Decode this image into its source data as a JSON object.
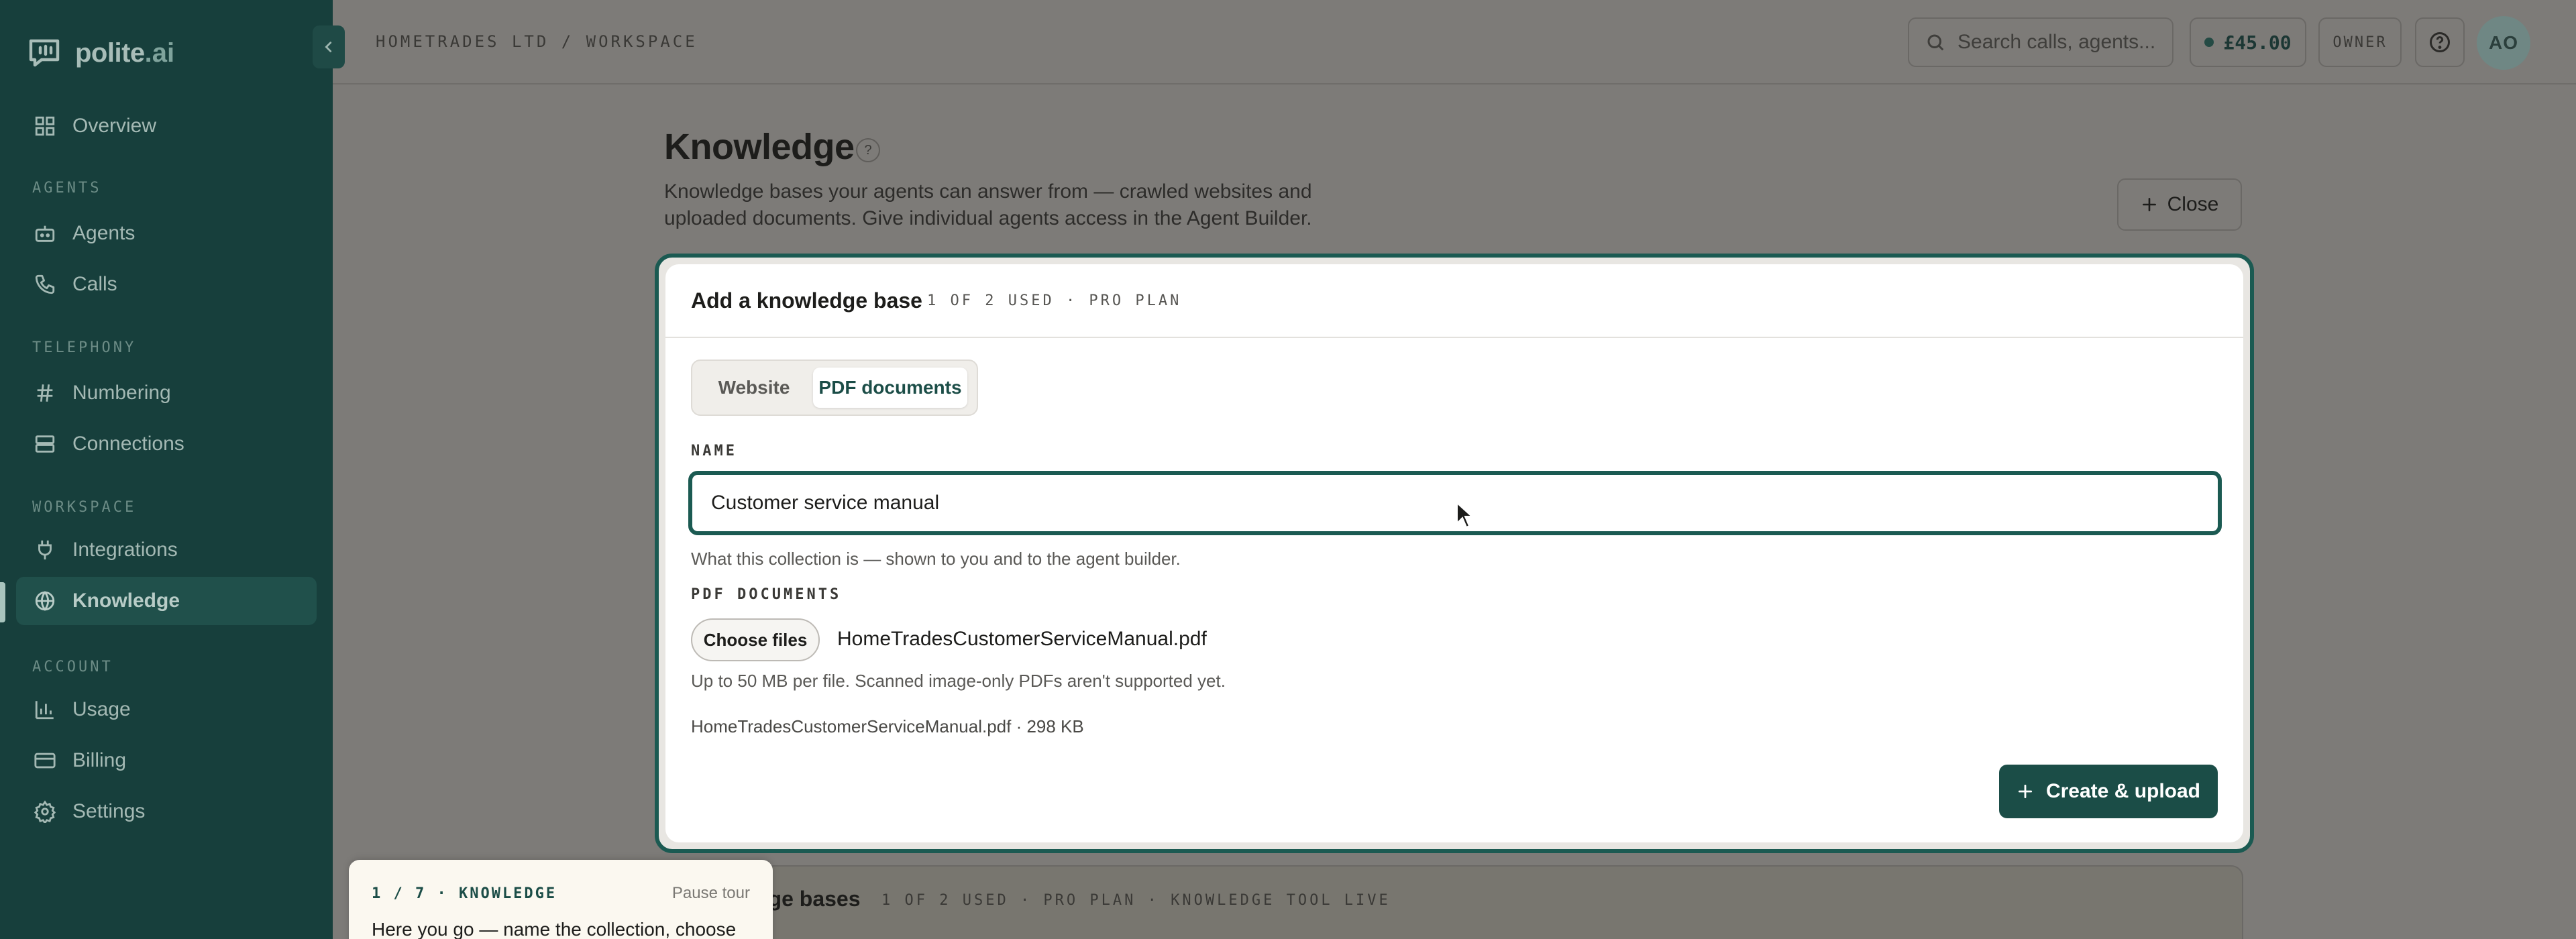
{
  "brand": {
    "name": "polite",
    "tld": ".ai"
  },
  "sidebar": {
    "sections": {
      "agents": "AGENTS",
      "telephony": "TELEPHONY",
      "workspace": "WORKSPACE",
      "account": "ACCOUNT"
    },
    "items": {
      "overview": "Overview",
      "agents": "Agents",
      "calls": "Calls",
      "numbering": "Numbering",
      "connections": "Connections",
      "integrations": "Integrations",
      "knowledge": "Knowledge",
      "usage": "Usage",
      "billing": "Billing",
      "settings": "Settings"
    },
    "active": "knowledge"
  },
  "topbar": {
    "breadcrumb": "HOMETRADES LTD / WORKSPACE",
    "search_placeholder": "Search calls, agents...",
    "credit": "£45.00",
    "role": "OWNER",
    "avatar": "AO"
  },
  "page": {
    "title": "Knowledge",
    "help_badge": "?",
    "description": "Knowledge bases your agents can answer from — crawled websites and uploaded documents. Give individual agents access in the Agent Builder.",
    "close_label": "Close"
  },
  "add_form": {
    "title": "Add a knowledge base",
    "meta": "1 OF 2 USED · PRO PLAN",
    "tabs": {
      "website": "Website",
      "pdf": "PDF documents"
    },
    "active_tab": "pdf",
    "name_label": "NAME",
    "name_value": "Customer service manual",
    "name_help": "What this collection is — shown to you and to the agent builder.",
    "pdf_label": "PDF DOCUMENTS",
    "choose_files": "Choose files",
    "chosen_file": "HomeTradesCustomerServiceManual.pdf",
    "pdf_help": "Up to 50 MB per file. Scanned image-only PDFs aren't supported yet.",
    "file_entry": "HomeTradesCustomerServiceManual.pdf · 298 KB",
    "submit_label": "Create & upload"
  },
  "list": {
    "title": "dge bases",
    "meta": "1 OF 2 USED · PRO PLAN · KNOWLEDGE TOOL LIVE"
  },
  "tour": {
    "step": "1 / 7 · KNOWLEDGE",
    "pause": "Pause tour",
    "body": "Here you go — name the collection, choose"
  },
  "colors": {
    "sidebar_bg": "#173f3c",
    "accent": "#1b4d47",
    "focus_ring": "#1b5a52",
    "overlay": "#7d7b78"
  }
}
